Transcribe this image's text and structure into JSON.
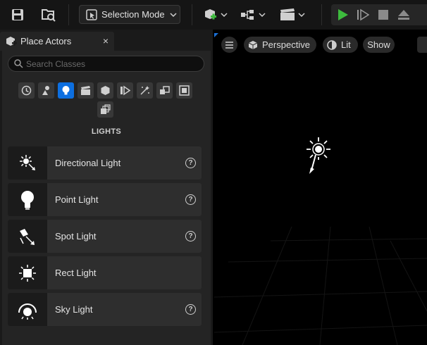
{
  "toolbar": {
    "mode_label": "Selection Mode",
    "icons": [
      "save-icon",
      "browse-icon",
      "add-actor-icon",
      "blueprint-icon",
      "cinematics-icon",
      "play-icon",
      "advance-icon",
      "stop-icon",
      "eject-icon"
    ],
    "play_color": "#3dbb3d"
  },
  "panel": {
    "title": "Place Actors",
    "close": "×",
    "search_placeholder": "Search Classes",
    "section": "LIGHTS",
    "accent": "#0d6fe0",
    "items": [
      {
        "label": "Directional Light",
        "help": "?"
      },
      {
        "label": "Point Light",
        "help": "?"
      },
      {
        "label": "Spot Light",
        "help": "?"
      },
      {
        "label": "Rect Light"
      },
      {
        "label": "Sky Light",
        "help": "?"
      }
    ]
  },
  "viewport": {
    "perspective_label": "Perspective",
    "lit_label": "Lit",
    "show_label": "Show"
  }
}
